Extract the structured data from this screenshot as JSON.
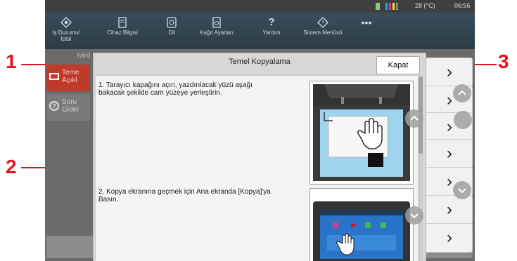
{
  "status": {
    "temperature": "28 (°C)",
    "time": "06:56"
  },
  "nav": [
    {
      "label": "İş Durumu/ İptal",
      "icon": "job-status-icon"
    },
    {
      "label": "Cihaz Bilgisi",
      "icon": "device-info-icon"
    },
    {
      "label": "Dil",
      "icon": "language-icon"
    },
    {
      "label": "Kağıt Ayarları",
      "icon": "paper-settings-icon"
    },
    {
      "label": "Yardım",
      "icon": "help-icon"
    },
    {
      "label": "Sistem Menüsü",
      "icon": "system-menu-icon"
    },
    {
      "label": "•••",
      "icon": "more-icon"
    }
  ],
  "left_tabs": {
    "help_top": "Yard",
    "tab1": "Teme Açıkl",
    "tab2": "Soru Gider"
  },
  "dialog": {
    "title": "Temel Kopyalama",
    "close_label": "Kapat",
    "steps": [
      "1. Tarayıcı kapağını açın, yazdırılacak yüzü aşağı bakacak şekilde cam yüzeye yerleştirin.",
      "2. Kopya ekranına geçmek için Ana ekranda [Kopya]'ya Basın."
    ]
  },
  "callouts": {
    "c1": "1",
    "c2": "2",
    "c3": "3"
  },
  "colors": {
    "callout": "#e1141c",
    "accent": "#5bc6f0"
  }
}
